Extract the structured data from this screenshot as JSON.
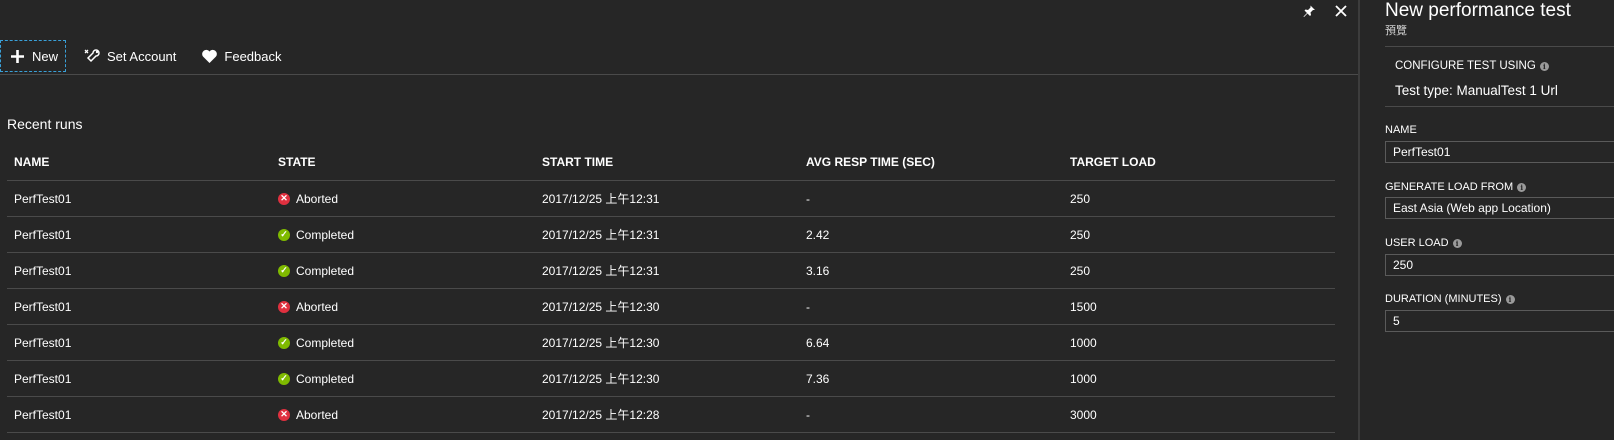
{
  "toolbar": {
    "new_label": "New",
    "set_account_label": "Set Account",
    "feedback_label": "Feedback"
  },
  "recent": {
    "title": "Recent runs",
    "columns": [
      "NAME",
      "STATE",
      "START TIME",
      "AVG RESP TIME (SEC)",
      "TARGET LOAD"
    ],
    "rows": [
      {
        "name": "PerfTest01",
        "state": "Aborted",
        "start": "2017/12/25 上午12:31",
        "avg": "-",
        "load": "250"
      },
      {
        "name": "PerfTest01",
        "state": "Completed",
        "start": "2017/12/25 上午12:31",
        "avg": "2.42",
        "load": "250"
      },
      {
        "name": "PerfTest01",
        "state": "Completed",
        "start": "2017/12/25 上午12:31",
        "avg": "3.16",
        "load": "250"
      },
      {
        "name": "PerfTest01",
        "state": "Aborted",
        "start": "2017/12/25 上午12:30",
        "avg": "-",
        "load": "1500"
      },
      {
        "name": "PerfTest01",
        "state": "Completed",
        "start": "2017/12/25 上午12:30",
        "avg": "6.64",
        "load": "1000"
      },
      {
        "name": "PerfTest01",
        "state": "Completed",
        "start": "2017/12/25 上午12:30",
        "avg": "7.36",
        "load": "1000"
      },
      {
        "name": "PerfTest01",
        "state": "Aborted",
        "start": "2017/12/25 上午12:28",
        "avg": "-",
        "load": "3000"
      }
    ]
  },
  "panel": {
    "title": "New performance test",
    "subtitle": "預覽",
    "configure_label": "CONFIGURE TEST USING",
    "test_type": "Test type: ManualTest 1 Url",
    "name_label": "NAME",
    "name_value": "PerfTest01",
    "load_from_label": "GENERATE LOAD FROM",
    "load_from_value": "East Asia (Web app Location)",
    "user_load_label": "USER LOAD",
    "user_load_value": "250",
    "duration_label": "DURATION (MINUTES)",
    "duration_value": "5"
  },
  "icons": {
    "pin": "pin-icon",
    "close": "close-icon",
    "new": "plus-icon",
    "set_account": "wrench-icon",
    "feedback": "heart-icon",
    "aborted": "error-x-icon",
    "completed": "check-circle-icon",
    "info": "info-icon"
  },
  "colors": {
    "background": "#262626",
    "aborted": "#e0303f",
    "completed": "#7fba00",
    "focus": "#3aa0d8"
  }
}
